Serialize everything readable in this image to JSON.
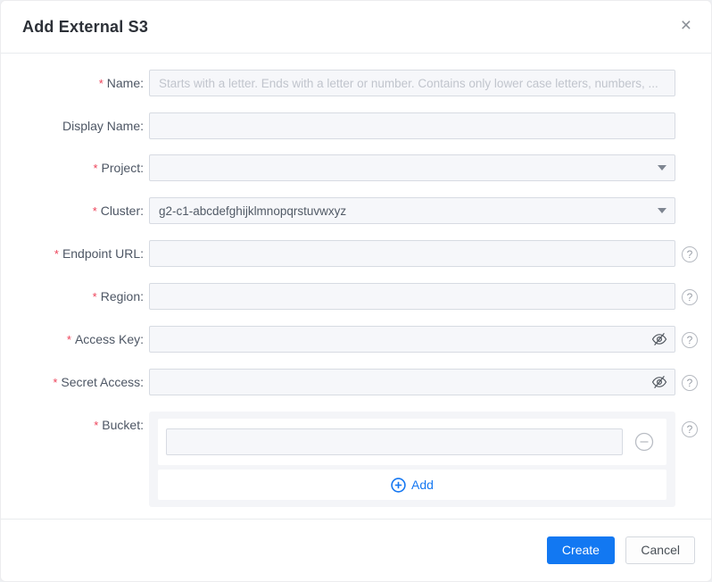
{
  "dialog": {
    "title": "Add External S3",
    "close_glyph": "×"
  },
  "form": {
    "name": {
      "required_mark": "*",
      "label": "Name:",
      "placeholder": "Starts with a letter. Ends with a letter or number. Contains only lower case letters, numbers, ...",
      "value": ""
    },
    "display_name": {
      "label": "Display Name:",
      "value": ""
    },
    "project": {
      "required_mark": "*",
      "label": "Project:",
      "value": ""
    },
    "cluster": {
      "required_mark": "*",
      "label": "Cluster:",
      "value": "g2-c1-abcdefghijklmnopqrstuvwxyz"
    },
    "endpoint_url": {
      "required_mark": "*",
      "label": "Endpoint URL:",
      "value": ""
    },
    "region": {
      "required_mark": "*",
      "label": "Region:",
      "value": ""
    },
    "access_key": {
      "required_mark": "*",
      "label": "Access Key:",
      "value": ""
    },
    "secret_access": {
      "required_mark": "*",
      "label": "Secret Access:",
      "value": ""
    },
    "bucket": {
      "required_mark": "*",
      "label": "Bucket:",
      "items": [
        {
          "value": ""
        }
      ],
      "add_label": "Add"
    }
  },
  "icons": {
    "help_glyph": "?"
  },
  "footer": {
    "create_label": "Create",
    "cancel_label": "Cancel"
  },
  "colors": {
    "primary": "#1278f2",
    "danger": "#ed4259"
  }
}
